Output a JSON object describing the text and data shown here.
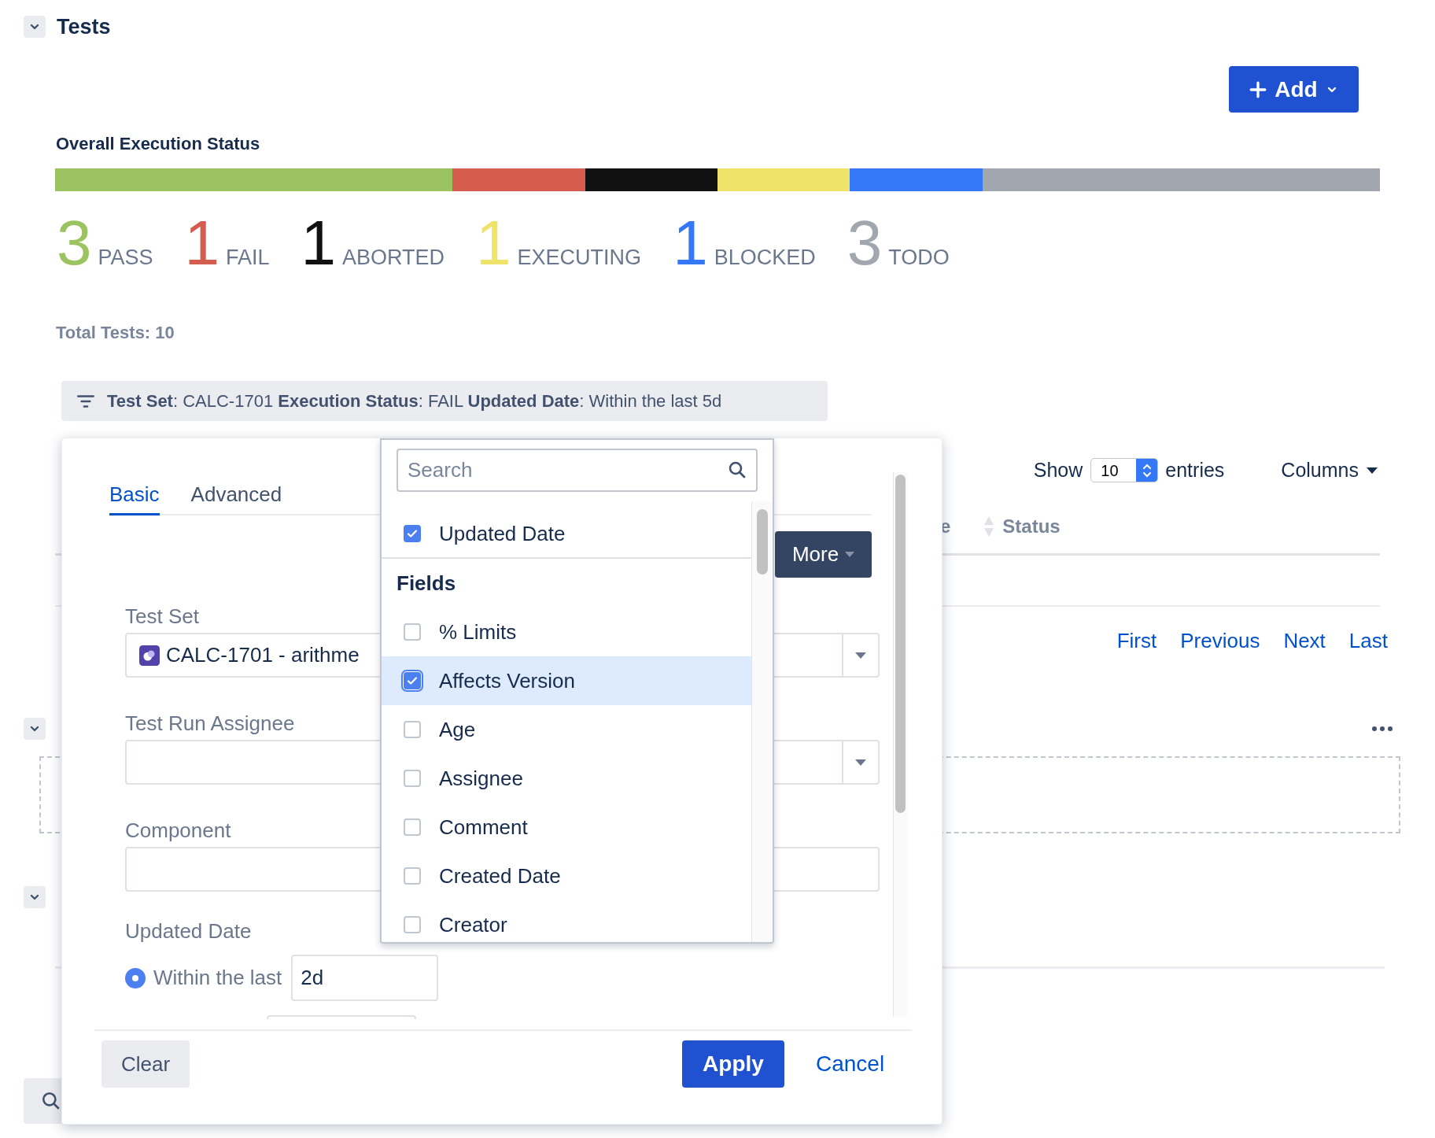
{
  "section": {
    "title": "Tests",
    "expanded": true
  },
  "add_button": {
    "label": "Add"
  },
  "execution_status": {
    "title": "Overall Execution Status",
    "statuses": [
      {
        "count": "3",
        "label": "PASS",
        "color": "#9bc461"
      },
      {
        "count": "1",
        "label": "FAIL",
        "color": "#d45d4f"
      },
      {
        "count": "1",
        "label": "ABORTED",
        "color": "#111111"
      },
      {
        "count": "1",
        "label": "EXECUTING",
        "color": "#efe36a"
      },
      {
        "count": "1",
        "label": "BLOCKED",
        "color": "#3578f7"
      },
      {
        "count": "3",
        "label": "TODO",
        "color": "#a2a6ae"
      }
    ]
  },
  "total_tests": "Total Tests: 10",
  "filter_summary": "**Test Set**: CALC-1701 **Execution Status**: FAIL **Updated Date**: Within the last 5d",
  "table": {
    "show_label": "Show",
    "page_size": "10",
    "entries_label": "entries",
    "columns_button": "Columns",
    "headers": [
      "e",
      "Status"
    ],
    "pagination": [
      "First",
      "Previous",
      "Next",
      "Last"
    ]
  },
  "lower_sections": [
    {
      "expanded": true
    },
    {
      "expanded": true
    }
  ],
  "filter_popup": {
    "tabs": [
      {
        "label": "Basic",
        "selected": true
      },
      {
        "label": "Advanced",
        "selected": false
      }
    ],
    "more_button": "More",
    "fields": [
      {
        "kind": "select",
        "label": "Test Set",
        "value": "CALC-1701 - arithme"
      },
      {
        "kind": "select",
        "label": "Test Run Assignee"
      },
      {
        "kind": "text",
        "label": "Component"
      },
      {
        "kind": "date",
        "label": "Updated Date",
        "option": "Within the last",
        "selected": true,
        "value": "2d"
      }
    ],
    "clear_button": "Clear",
    "apply_button": "Apply",
    "cancel_button": "Cancel"
  },
  "field_picker": {
    "search_placeholder": "Search",
    "pinned": [
      {
        "label": "Updated Date",
        "checked": true
      }
    ],
    "group_title": "Fields",
    "items": [
      {
        "label": "% Limits",
        "checked": false,
        "selected": false
      },
      {
        "label": "Affects Version",
        "checked": true,
        "selected": true
      },
      {
        "label": "Age",
        "checked": false,
        "selected": false
      },
      {
        "label": "Assignee",
        "checked": false,
        "selected": false
      },
      {
        "label": "Comment",
        "checked": false,
        "selected": false
      },
      {
        "label": "Created Date",
        "checked": false,
        "selected": false
      },
      {
        "label": "Creator",
        "checked": false,
        "selected": false
      }
    ]
  }
}
